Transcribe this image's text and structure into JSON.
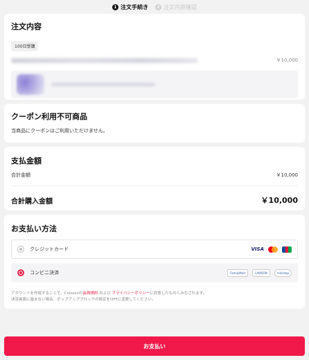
{
  "steps": [
    {
      "num": "1",
      "label": "注文手続き"
    },
    {
      "num": "2",
      "label": "注文内容確認"
    }
  ],
  "order": {
    "title": "注文内容",
    "badge": "100日受講",
    "item_price": "￥10,000"
  },
  "coupon": {
    "title": "クーポン利用不可商品",
    "message": "当商品にクーポンはご利用いただけません。"
  },
  "amount": {
    "title": "支払金額",
    "subtotal_label": "合計金額",
    "subtotal_value": "￥10,000",
    "total_label": "合計購入金額",
    "total_value": "￥10,000"
  },
  "method": {
    "title": "お支払い方法",
    "options": [
      {
        "label": "クレジットカード",
        "selected": false
      },
      {
        "label": "コンビニ決済",
        "selected": true
      }
    ],
    "card_logos": [
      "VISA",
      "mastercard",
      "JCB"
    ],
    "store_logos": [
      "FamilyMart",
      "LAWSON",
      "ministop"
    ],
    "notice_line1_pre": "アカウントを作成することで、Colossoの",
    "notice_link1": "会員規約",
    "notice_mid": "および",
    "notice_link2": "プライバシーポリシー",
    "notice_line1_post": "に同意したものとみなされます。",
    "notice_line2": "決済画面に進まない場合、ポップアップブロックの設定をOFFに変更してください。"
  },
  "pay_button": "お支払い",
  "colors": {
    "accent": "#f0194a",
    "background": "#f2f2f2"
  }
}
